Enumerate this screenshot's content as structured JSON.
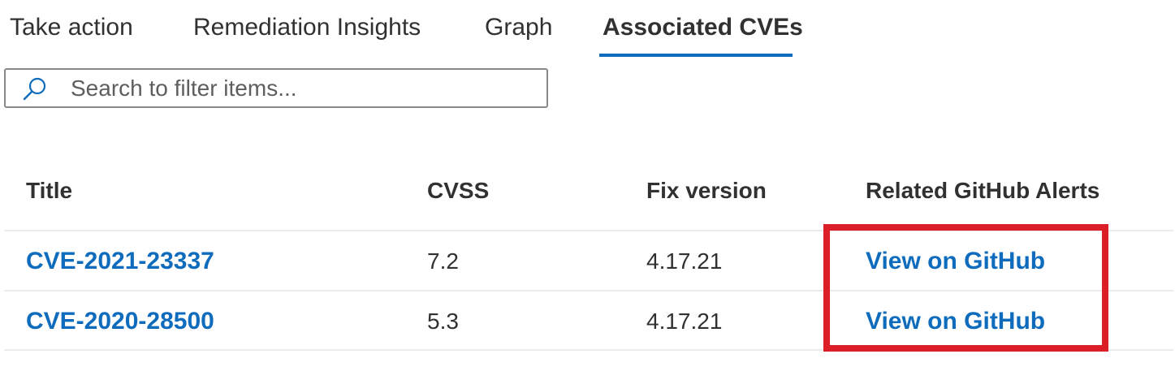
{
  "tabs": [
    {
      "label": "Take action"
    },
    {
      "label": "Remediation Insights"
    },
    {
      "label": "Graph"
    },
    {
      "label": "Associated CVEs",
      "active": true
    }
  ],
  "search": {
    "placeholder": "Search to filter items...",
    "value": ""
  },
  "table": {
    "headers": [
      "Title",
      "CVSS",
      "Fix version",
      "Related GitHub Alerts"
    ],
    "rows": [
      {
        "title": "CVE-2021-23337",
        "cvss": "7.2",
        "fix_version": "4.17.21",
        "github": "View on GitHub"
      },
      {
        "title": "CVE-2020-28500",
        "cvss": "5.3",
        "fix_version": "4.17.21",
        "github": "View on GitHub"
      }
    ]
  },
  "colors": {
    "accent": "#0f6cbd",
    "highlight": "#dc1f26",
    "text": "#323130",
    "divider": "#edebe9"
  },
  "icons": {
    "search": "search-icon"
  }
}
